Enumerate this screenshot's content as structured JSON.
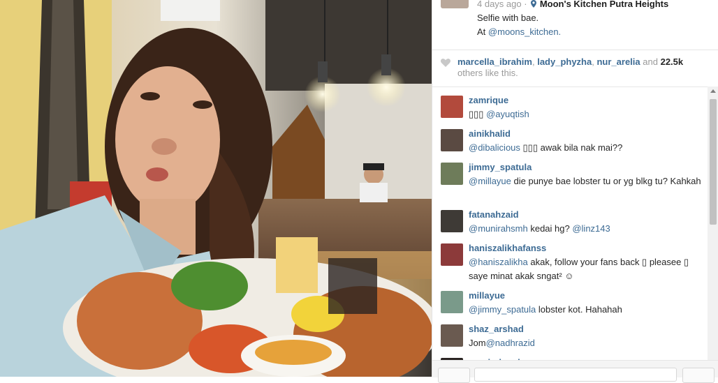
{
  "post": {
    "time_ago": "4 days ago",
    "separator": "·",
    "location": "Moon's Kitchen Putra Heights",
    "caption_line1": "Selfie with bae.",
    "caption_at": "At",
    "caption_mention": "@moons_kitchen."
  },
  "likes": {
    "users": [
      "marcella_ibrahim",
      "lady_phyzha",
      "nur_arelia"
    ],
    "sep1": ",",
    "sep2": ",",
    "and_text": "and",
    "count": "22.5k",
    "suffix": "others like this."
  },
  "comments": [
    {
      "user": "zamrique",
      "text_parts": [
        "▯▯▯ ",
        "@ayuqtish",
        ""
      ]
    },
    {
      "user": "ainikhalid",
      "text_parts": [
        "",
        "@dibalicious",
        " ▯▯▯ awak bila nak mai??"
      ]
    },
    {
      "user": "jimmy_spatula",
      "text_parts": [
        "",
        "@millayue",
        " die punye bae lobster tu or yg blkg tu? Kahkah"
      ]
    },
    {
      "user": "fatanahzaid",
      "text_parts": [
        "",
        "@munirahsmh",
        " kedai hg? ",
        "@linz143"
      ]
    },
    {
      "user": "haniszalikhafanss",
      "text_parts": [
        "",
        "@haniszalikha",
        " akak, follow your fans back ▯ pleasee ▯ saye minat akak sngat² ☺"
      ]
    },
    {
      "user": "millayue",
      "text_parts": [
        "",
        "@jimmy_spatula",
        " lobster kot. Hahahah"
      ]
    },
    {
      "user": "shaz_arshad",
      "text_parts": [
        "Jom",
        "@nadhrazid",
        ""
      ]
    },
    {
      "user": "munirahsmh",
      "text_parts": [
        "",
        "",
        ""
      ]
    }
  ],
  "colors": {
    "link": "#3d6b94",
    "muted": "#9a9a9a"
  }
}
